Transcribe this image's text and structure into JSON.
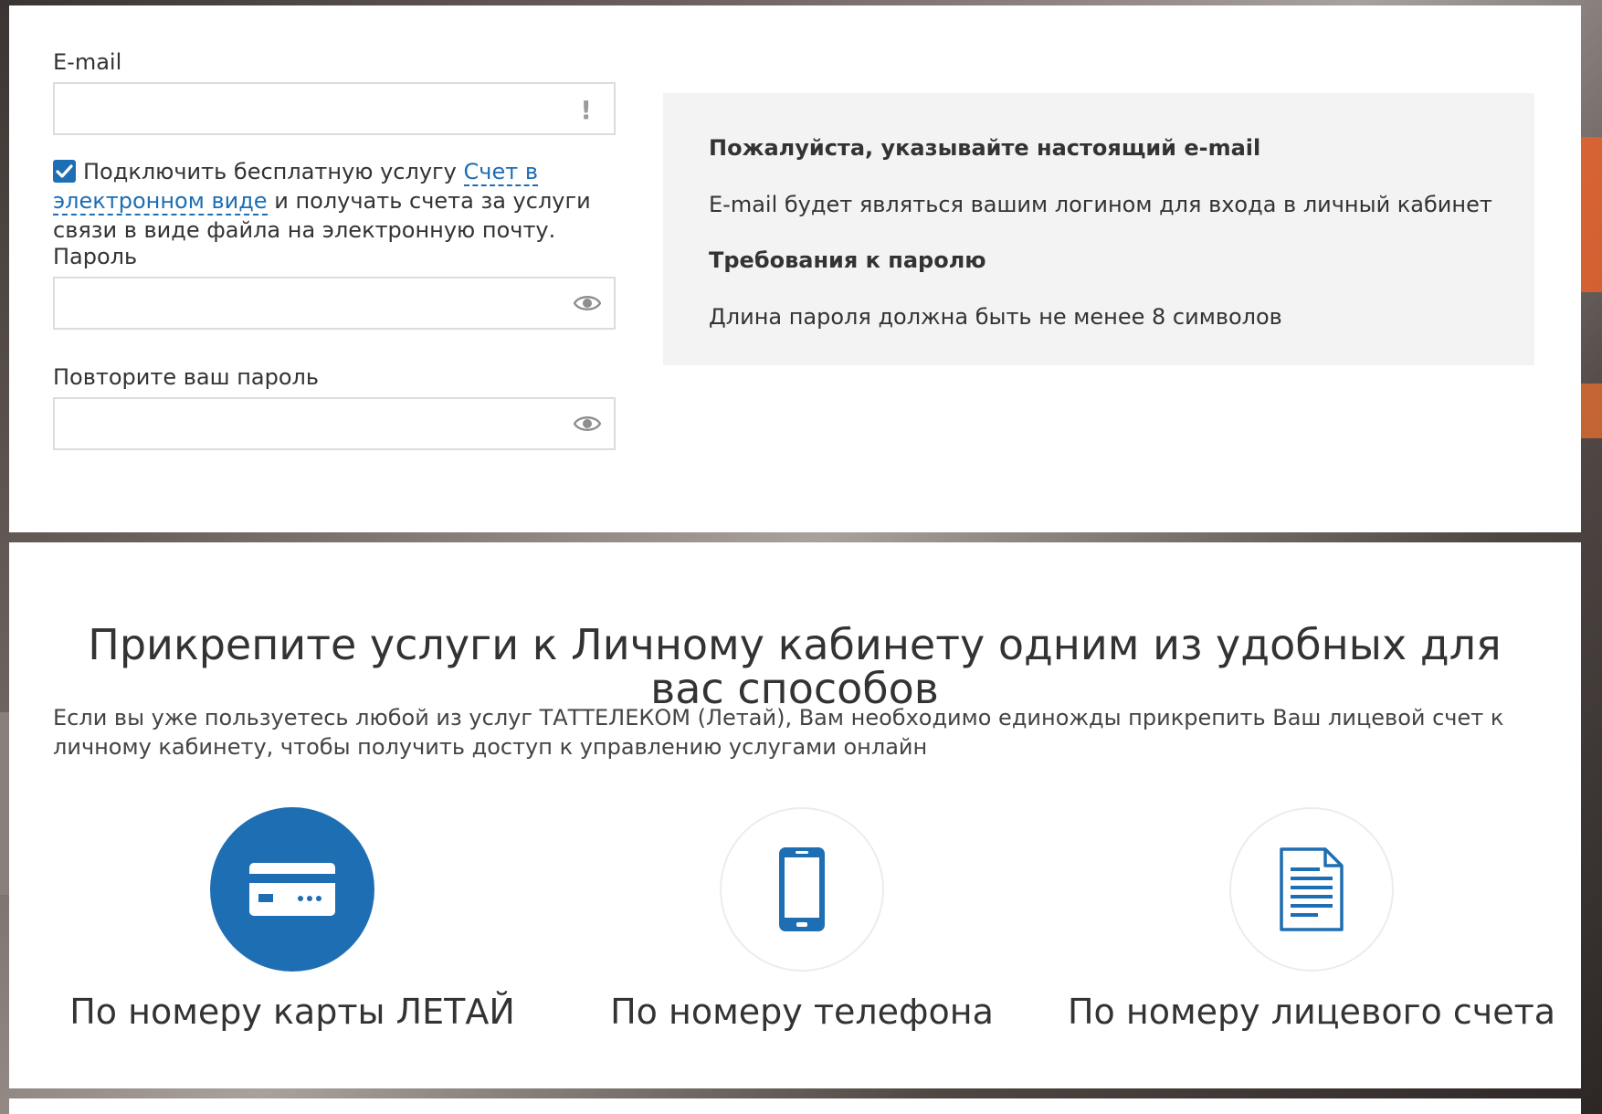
{
  "registration": {
    "email": {
      "label": "E-mail",
      "value": "",
      "placeholder": "",
      "warning_glyph": "!"
    },
    "consent": {
      "checked": true,
      "text_before": "Подключить бесплатную услугу",
      "link_text": "Счет в электронном виде",
      "text_after": "и получать счета за услуги связи в виде файла на электронную почту."
    },
    "password": {
      "label": "Пароль",
      "value": "",
      "icon": "eye-icon"
    },
    "password_repeat": {
      "label": "Повторите ваш пароль",
      "value": "",
      "icon": "eye-icon"
    }
  },
  "info": {
    "email_heading": "Пожалуйста, указывайте настоящий e-mail",
    "email_text": "E-mail будет являться вашим логином для входа в личный кабинет",
    "password_heading": "Требования к паролю",
    "password_text": "Длина пароля должна быть не менее 8 символов"
  },
  "attach": {
    "title": "Прикрепите услуги к Личному кабинету одним из удобных для вас способов",
    "description": "Если вы уже пользуетесь любой из услуг ТАТТЕЛЕКОМ (Летай), Вам необходимо единожды прикрепить Ваш лицевой счет к личному кабинету, чтобы получить доступ к управлению услугами онлайн",
    "options": [
      {
        "label": "По номеру карты ЛЕТАЙ",
        "icon": "credit-card-icon",
        "selected": true
      },
      {
        "label": "По номеру телефона",
        "icon": "smartphone-icon",
        "selected": false
      },
      {
        "label": "По номеру лицевого счета",
        "icon": "document-icon",
        "selected": false
      }
    ]
  },
  "colors": {
    "accent": "#1e6eb3",
    "info_bg": "#f3f3f3",
    "border": "#dcdcdc"
  }
}
